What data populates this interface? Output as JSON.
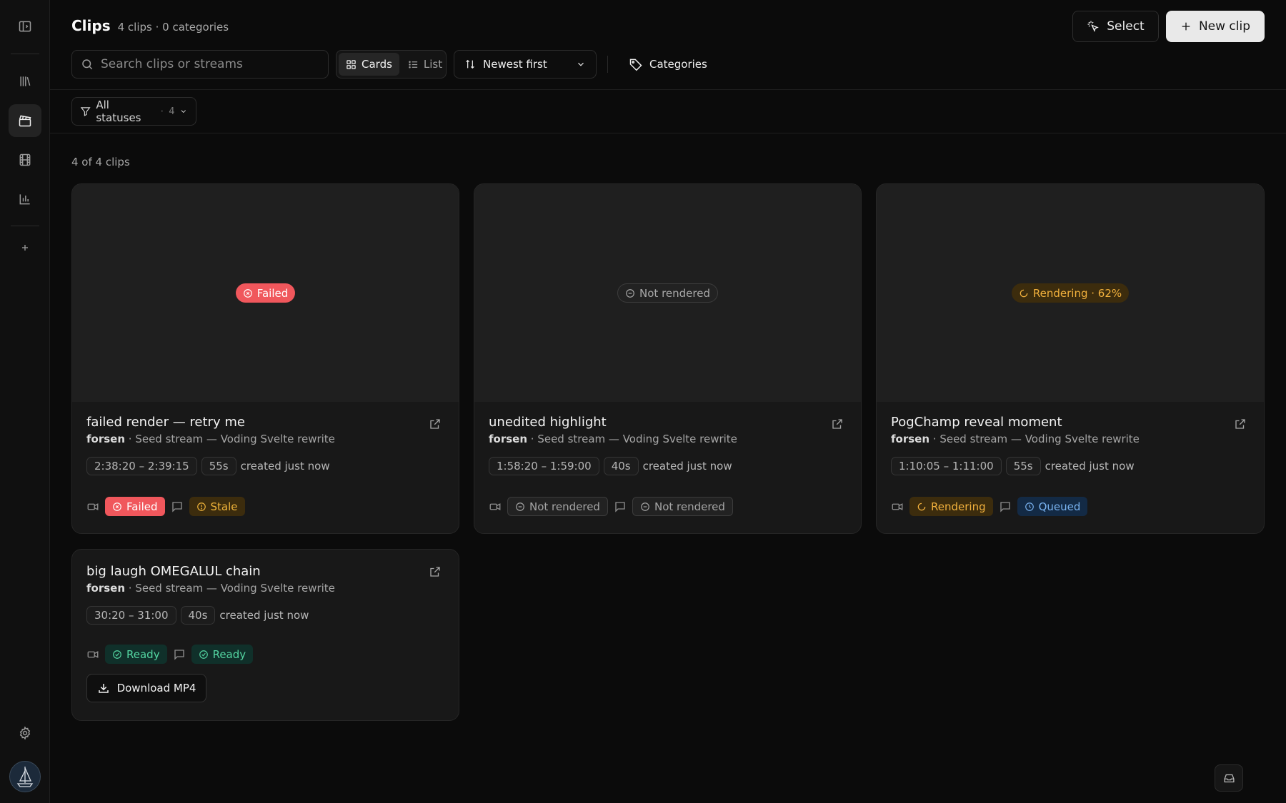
{
  "header": {
    "title": "Clips",
    "meta": "4 clips · 0 categories",
    "select_label": "Select",
    "new_clip_label": "New clip"
  },
  "toolbar": {
    "search_placeholder": "Search clips or streams",
    "view_cards": "Cards",
    "view_list": "List",
    "sort_label": "Newest first",
    "categories_label": "Categories"
  },
  "filter": {
    "label": "All statuses",
    "separator": "·",
    "count": "4"
  },
  "result_count": "4 of 4 clips",
  "cards": [
    {
      "title": "failed render — retry me",
      "streamer": "forsen",
      "stream": " · Seed stream — Voding Svelte rewrite",
      "range": "2:38:20 – 2:39:15",
      "duration": "55s",
      "created": "created just now",
      "overlay": "Failed",
      "video_status": "Failed",
      "chat_status": "Stale"
    },
    {
      "title": "unedited highlight",
      "streamer": "forsen",
      "stream": " · Seed stream — Voding Svelte rewrite",
      "range": "1:58:20 – 1:59:00",
      "duration": "40s",
      "created": "created just now",
      "overlay": "Not rendered",
      "video_status": "Not rendered",
      "chat_status": "Not rendered"
    },
    {
      "title": "PogChamp reveal moment",
      "streamer": "forsen",
      "stream": " · Seed stream — Voding Svelte rewrite",
      "range": "1:10:05 – 1:11:00",
      "duration": "55s",
      "created": "created just now",
      "overlay": "Rendering · 62%",
      "video_status": "Rendering",
      "chat_status": "Queued"
    },
    {
      "title": "big laugh OMEGALUL chain",
      "streamer": "forsen",
      "stream": " · Seed stream — Voding Svelte rewrite",
      "range": "30:20 – 31:00",
      "duration": "40s",
      "created": "created just now",
      "video_status": "Ready",
      "chat_status": "Ready",
      "download_label": "Download MP4"
    }
  ],
  "colors": {
    "failed": "#f0575c",
    "warning": "#f2b13d",
    "queued": "#79b2ef",
    "ready": "#54d6a2"
  }
}
